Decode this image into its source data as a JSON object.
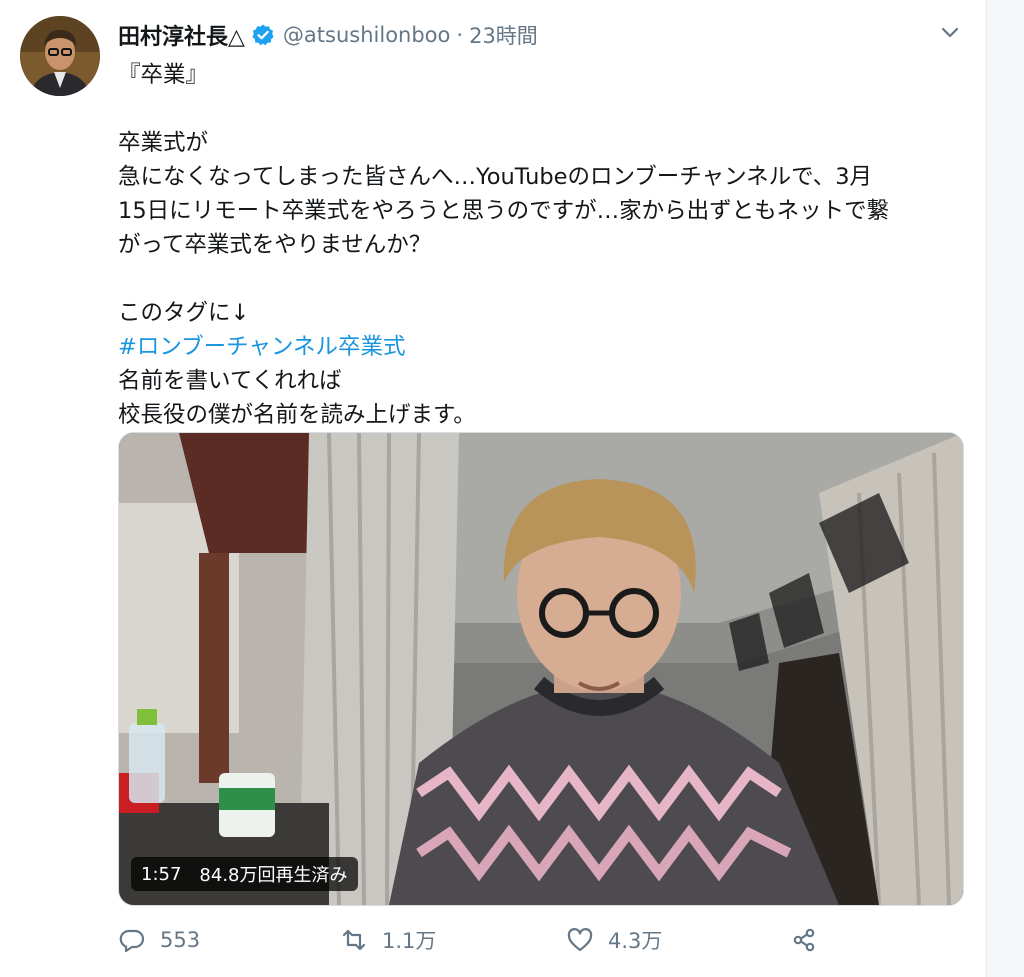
{
  "tweet": {
    "author_name": "田村淳社長△",
    "handle": "@atsushilonboo",
    "separator": "·",
    "time": "23時間",
    "lines": [
      "『卒業』",
      "",
      "卒業式が",
      "急になくなってしまった皆さんへ…YouTubeのロンブーチャンネルで、3月",
      "15日にリモート卒業式をやろうと思うのですが…家から出ずともネットで繋",
      "がって卒業式をやりませんか？",
      "",
      "このタグに↓",
      "#ロンブーチャンネル卒業式",
      "名前を書いてくれれば",
      "校長役の僕が名前を読み上げます。"
    ],
    "hashtag_line_index": 8,
    "video": {
      "duration": "1:57",
      "views": "84.8万回再生済み"
    },
    "actions": {
      "reply_count": "553",
      "retweet_count": "1.1万",
      "like_count": "4.3万"
    }
  },
  "icons": {
    "verified": "verified-badge-icon",
    "menu": "chevron-down-icon",
    "reply": "reply-icon",
    "retweet": "retweet-icon",
    "like": "heart-icon",
    "share": "share-icon"
  },
  "colors": {
    "accent": "#1b95e0",
    "secondary_text": "#657786",
    "primary_text": "#14171a"
  }
}
